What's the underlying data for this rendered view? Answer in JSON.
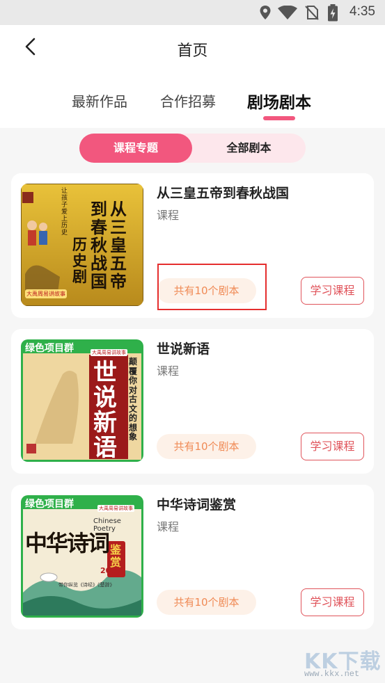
{
  "status_bar": {
    "time": "4:35",
    "icons": [
      "location-icon",
      "wifi-icon",
      "no-sim-icon",
      "battery-charging-icon"
    ]
  },
  "header": {
    "title": "首页",
    "back_icon": "chevron-left-icon"
  },
  "tabs": [
    {
      "label": "最新作品",
      "active": false
    },
    {
      "label": "合作招募",
      "active": false
    },
    {
      "label": "剧场剧本",
      "active": true
    }
  ],
  "segmented": [
    {
      "label": "课程专题",
      "active": true
    },
    {
      "label": "全部剧本",
      "active": false
    }
  ],
  "cards": [
    {
      "title": "从三皇五帝到春秋战国",
      "subtitle": "课程",
      "count": "共有10个剧本",
      "button": "学习课程",
      "cover": {
        "main_right": "从三皇五帝",
        "main_left": "到春秋战国",
        "side": "历史剧",
        "tag": "让孩子爱上历史",
        "badge": "大禹周易讲故事"
      }
    },
    {
      "title": "世说新语",
      "subtitle": "课程",
      "count": "共有10个剧本",
      "button": "学习课程",
      "cover": {
        "banner": "绿色项目群",
        "main": "世说新语",
        "side": "颠覆你对古文的想象",
        "badge": "大禹周易讲故事"
      }
    },
    {
      "title": "中华诗词鉴赏",
      "subtitle": "课程",
      "count": "共有10个剧本",
      "button": "学习课程",
      "cover": {
        "banner": "绿色项目群",
        "main": "中华诗词",
        "english": "Chinese Poetry",
        "seal": "鉴赏",
        "lessons": "200节",
        "caption": "带你纵览《诗经》《楚辞》",
        "badge": "大禹周易讲故事"
      }
    }
  ],
  "watermark": {
    "text": "KK下载",
    "url": "www.kkx.net"
  },
  "colors": {
    "accent": "#f2577e",
    "pill_bg": "#fdf1e8",
    "pill_text": "#f08a55",
    "button_border": "#e0535a",
    "highlight": "#e52e2e"
  }
}
